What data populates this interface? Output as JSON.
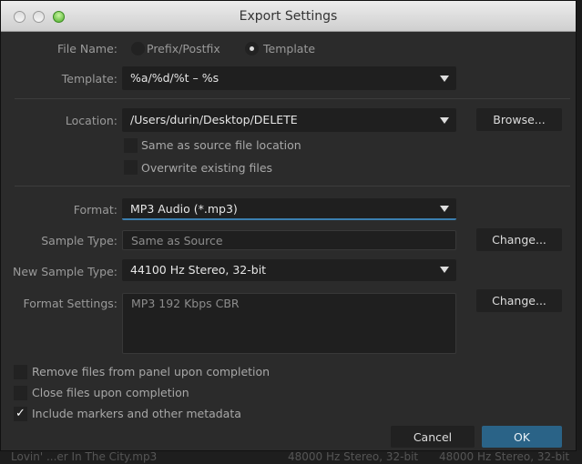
{
  "window": {
    "title": "Export Settings"
  },
  "file_name": {
    "label": "File Name:",
    "options": [
      {
        "label": "Prefix/Postfix",
        "selected": false
      },
      {
        "label": "Template",
        "selected": true
      }
    ]
  },
  "template": {
    "label": "Template:",
    "value": "%a/%d/%t – %s"
  },
  "location": {
    "label": "Location:",
    "value": "/Users/durin/Desktop/DELETE",
    "browse_label": "Browse...",
    "same_as_source": {
      "label": "Same as source file location",
      "checked": false
    },
    "overwrite": {
      "label": "Overwrite existing files",
      "checked": false
    }
  },
  "format": {
    "label": "Format:",
    "value": "MP3 Audio (*.mp3)"
  },
  "sample_type": {
    "label": "Sample Type:",
    "value": "Same as Source",
    "change_label": "Change..."
  },
  "new_sample_type": {
    "label": "New Sample Type:",
    "value": "44100 Hz Stereo, 32-bit"
  },
  "format_settings": {
    "label": "Format Settings:",
    "value": "MP3 192 Kbps CBR",
    "change_label": "Change..."
  },
  "options": [
    {
      "label": "Remove files from panel upon completion",
      "checked": false
    },
    {
      "label": "Close files upon completion",
      "checked": false
    },
    {
      "label": "Include markers and other metadata",
      "checked": true
    }
  ],
  "buttons": {
    "cancel": "Cancel",
    "ok": "OK"
  },
  "background": {
    "file": "Lovin' ...er In The City.mp3",
    "col1": "48000 Hz Stereo, 32-bit",
    "col2": "48000 Hz Stereo, 32-bit"
  },
  "colors": {
    "accent": "#2a6387",
    "focus_underline": "#3b7fb0"
  }
}
